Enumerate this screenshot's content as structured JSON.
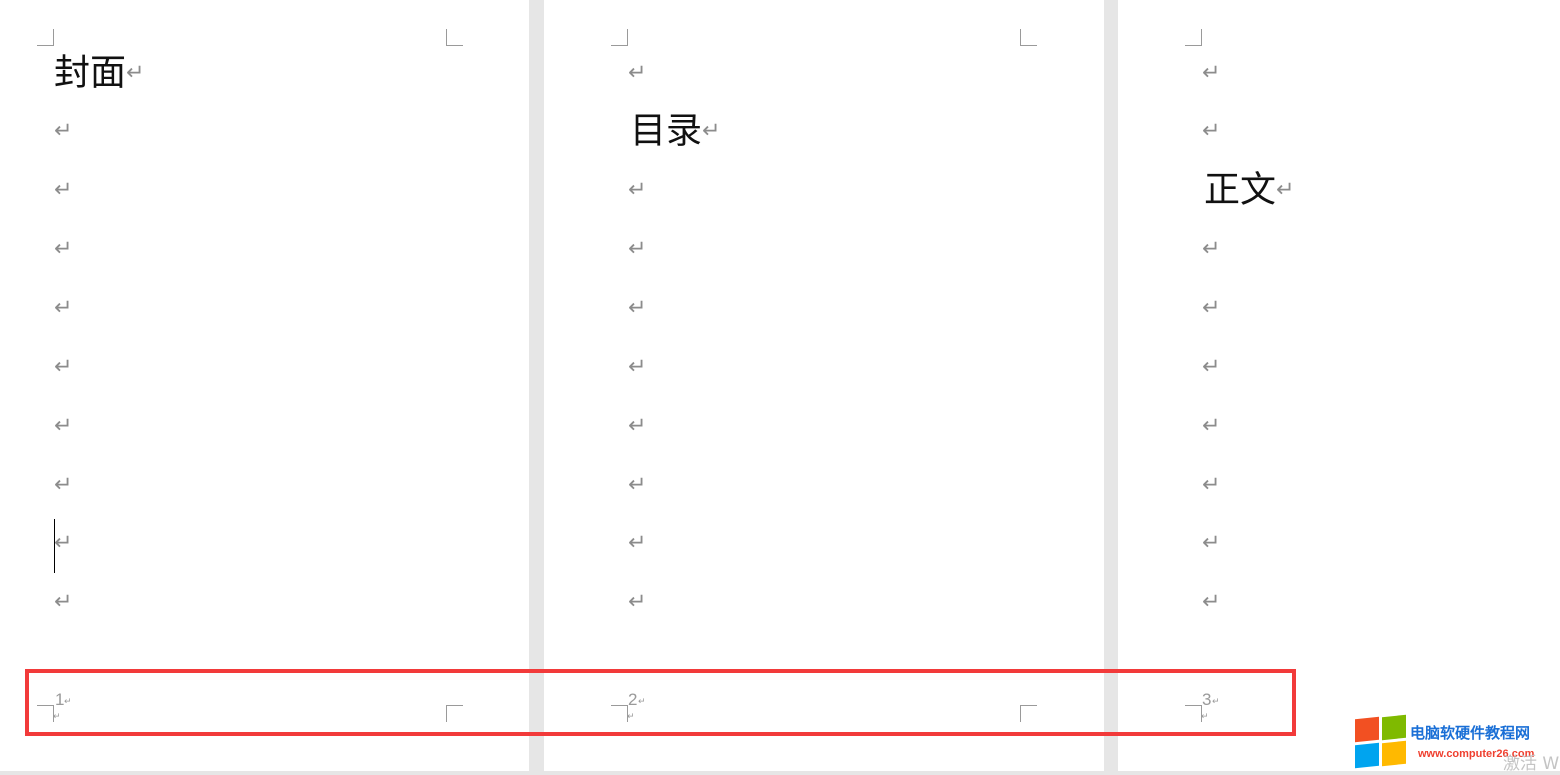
{
  "pages": [
    {
      "heading": "封面",
      "page_number": "1"
    },
    {
      "heading": "目录",
      "page_number": "2"
    },
    {
      "heading": "正文",
      "page_number": "3"
    }
  ],
  "paragraph_mark": "↵",
  "small_mark": "↵",
  "watermark": {
    "site_name": "电脑软硬件教程网",
    "site_url": "www.computer26.com",
    "logo_colors": [
      "#f25022",
      "#7fba00",
      "#00a4ef",
      "#ffb900"
    ]
  },
  "activation_text": "激活 W",
  "highlight_color": "#f23a3a"
}
